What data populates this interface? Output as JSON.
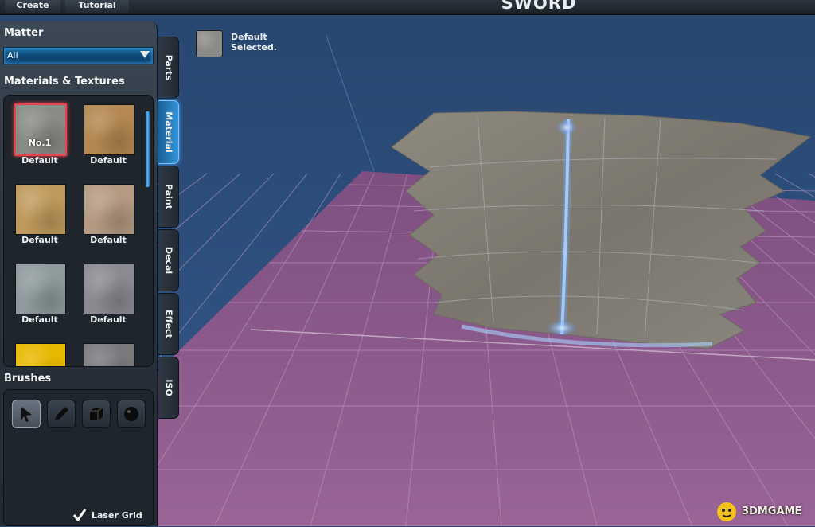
{
  "topbar": {
    "tabs": [
      {
        "label": "Create"
      },
      {
        "label": "Tutorial"
      }
    ],
    "title": "SWORD"
  },
  "left_panel": {
    "matter_title": "Matter",
    "matter_select_value": "All",
    "materials_title": "Materials & Textures",
    "materials": [
      {
        "label": "Default",
        "number": "No.1",
        "selected": true,
        "color": "#8a8a86"
      },
      {
        "label": "Default",
        "color": "#b48850"
      },
      {
        "label": "Default",
        "color": "#c09a5c"
      },
      {
        "label": "Default",
        "color": "#b49a82"
      },
      {
        "label": "Default",
        "color": "#8e9a9c"
      },
      {
        "label": "Default",
        "color": "#8a8a90"
      },
      {
        "label": "",
        "color": "#e8b800"
      },
      {
        "label": "",
        "color": "#7a7a7e"
      }
    ],
    "brushes_title": "Brushes",
    "brushes": [
      {
        "name": "select-arrow-icon",
        "active": true
      },
      {
        "name": "pencil-icon",
        "active": false
      },
      {
        "name": "cube-icon",
        "active": false
      },
      {
        "name": "sphere-icon",
        "active": false
      }
    ],
    "laser_grid_label": "Laser Grid",
    "laser_grid_checked": true
  },
  "side_tabs": [
    {
      "label": "Parts",
      "active": false
    },
    {
      "label": "Material",
      "active": true
    },
    {
      "label": "Paint",
      "active": false
    },
    {
      "label": "Decal",
      "active": false
    },
    {
      "label": "Effect",
      "active": false
    },
    {
      "label": "ISO",
      "active": false
    }
  ],
  "selection": {
    "line1": "Default",
    "line2": "Selected."
  },
  "colors": {
    "sky": "#2c4c78",
    "grid_floor": "#8a5a8c",
    "grid_line": "#c7a4c8",
    "accent_blue": "#3a9be0",
    "selected_red": "#e0474a"
  },
  "watermark": {
    "text": "3DMGAME"
  }
}
